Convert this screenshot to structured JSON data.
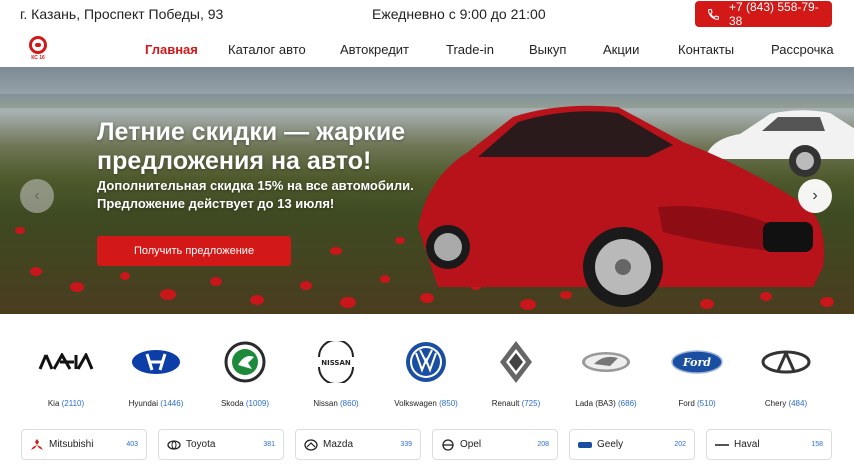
{
  "topbar": {
    "address": "г. Казань, Проспект Победы, 93",
    "hours": "Ежедневно с 9:00 до 21:00",
    "phone": "+7 (843) 558-79-38"
  },
  "logo": {
    "text": "КС 16"
  },
  "nav": {
    "items": [
      {
        "label": "Главная"
      },
      {
        "label": "Каталог авто"
      },
      {
        "label": "Автокредит"
      },
      {
        "label": "Trade-in"
      },
      {
        "label": "Выкуп"
      },
      {
        "label": "Акции"
      },
      {
        "label": "Контакты"
      },
      {
        "label": "Рассрочка"
      }
    ]
  },
  "hero": {
    "title": "Летние скидки — жаркие предложения на авто!",
    "subtitle": "Дополнительная скидка 15% на все автомобили. Предложение действует до 13 июля!",
    "cta": "Получить предложение",
    "prev": "‹",
    "next": "›"
  },
  "brands": [
    {
      "name": "Kia",
      "count": "(2110)"
    },
    {
      "name": "Hyundai",
      "count": "(1446)"
    },
    {
      "name": "Skoda",
      "count": "(1009)"
    },
    {
      "name": "Nissan",
      "count": "(860)"
    },
    {
      "name": "Volkswagen",
      "count": "(850)"
    },
    {
      "name": "Renault",
      "count": "(725)"
    },
    {
      "name": "Lada (ВАЗ)",
      "count": "(686)"
    },
    {
      "name": "Ford",
      "count": "(510)"
    },
    {
      "name": "Chery",
      "count": "(484)"
    }
  ],
  "cards": [
    {
      "name": "Mitsubishi",
      "count": "403"
    },
    {
      "name": "Toyota",
      "count": "381"
    },
    {
      "name": "Mazda",
      "count": "339"
    },
    {
      "name": "Opel",
      "count": "208"
    },
    {
      "name": "Geely",
      "count": "202"
    },
    {
      "name": "Haval",
      "count": "158"
    }
  ],
  "colors": {
    "accent": "#d31818",
    "count": "#2b6cd2"
  }
}
